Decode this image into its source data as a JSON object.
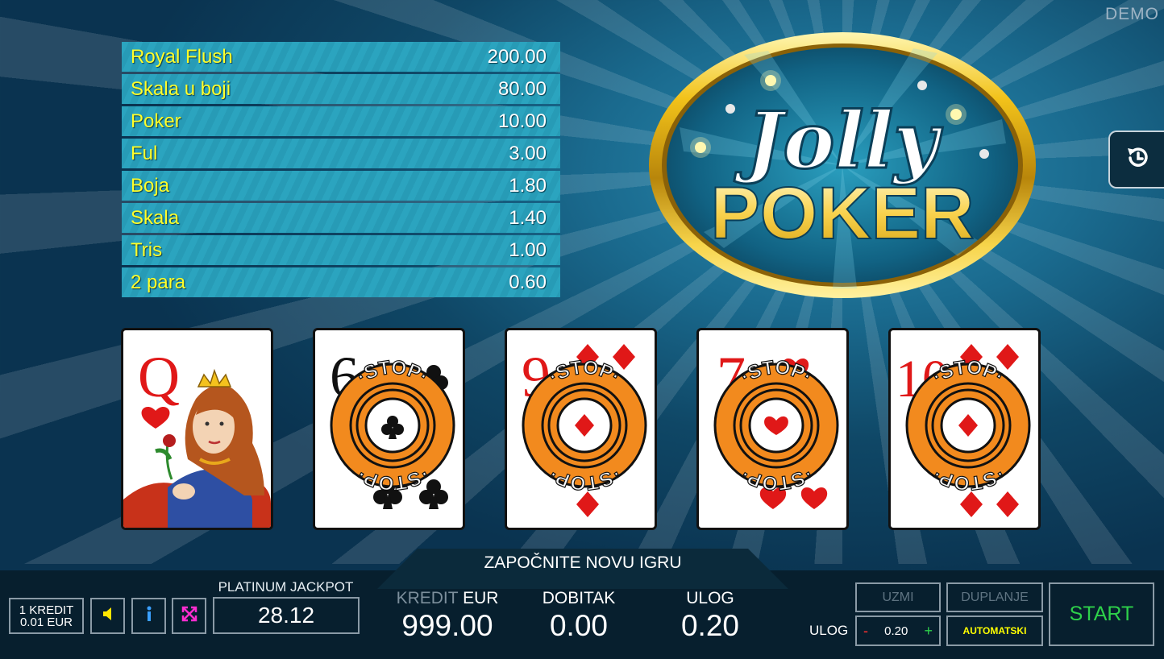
{
  "demo_label": "DEMO",
  "paytable": [
    {
      "name": "Royal Flush",
      "value": "200.00"
    },
    {
      "name": "Skala u boji",
      "value": "80.00"
    },
    {
      "name": "Poker",
      "value": "10.00"
    },
    {
      "name": "Ful",
      "value": "3.00"
    },
    {
      "name": "Boja",
      "value": "1.80"
    },
    {
      "name": "Skala",
      "value": "1.40"
    },
    {
      "name": "Tris",
      "value": "1.00"
    },
    {
      "name": "2 para",
      "value": "0.60"
    }
  ],
  "logo": {
    "line1": "Jolly",
    "line2": "POKER"
  },
  "cards": [
    {
      "rank": "Q",
      "suit": "hearts",
      "held_stop": false
    },
    {
      "rank": "6",
      "suit": "clubs",
      "held_stop": true
    },
    {
      "rank": "9",
      "suit": "diamonds",
      "held_stop": true
    },
    {
      "rank": "7",
      "suit": "hearts",
      "held_stop": true
    },
    {
      "rank": "10",
      "suit": "diamonds",
      "held_stop": true
    }
  ],
  "stop_text": "STOP",
  "message": "ZAPOČNITE NOVU IGRU",
  "credit_info": {
    "line1": "1 KREDIT",
    "line2": "0.01 EUR"
  },
  "jackpot": {
    "label": "PLATINUM JACKPOT",
    "value": "28.12"
  },
  "kredit": {
    "label_grey": "KREDIT",
    "label_white": "EUR",
    "value": "999.00"
  },
  "dobitak": {
    "label": "DOBITAK",
    "value": "0.00"
  },
  "ulog": {
    "label": "ULOG",
    "value": "0.20"
  },
  "buttons": {
    "uzmi": "UZMI",
    "duplanje": "DUPLANJE",
    "ulog_label": "ULOG",
    "stepper_value": "0.20",
    "minus": "-",
    "plus": "+",
    "automatski": "AUTOMATSKI",
    "start": "START"
  },
  "colors": {
    "paytable_name": "#ffff2a",
    "start_green": "#2ed14a",
    "expand_magenta": "#ff2dcf",
    "info_blue": "#3aa0ff",
    "sound_yellow": "#ffe600",
    "stop_orange": "#f28a1e"
  },
  "icons": [
    "history-icon",
    "speaker-icon",
    "info-icon",
    "expand-icon"
  ]
}
